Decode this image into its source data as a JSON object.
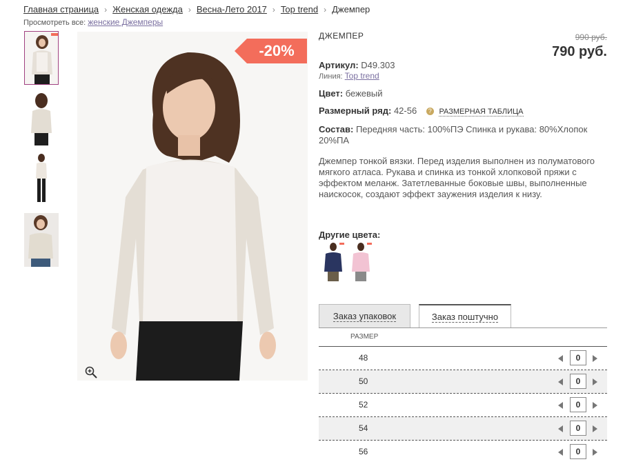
{
  "breadcrumb": {
    "items": [
      "Главная страница",
      "Женская одежда",
      "Весна-Лето 2017",
      "Top trend"
    ],
    "separator": "›",
    "current": "Джемпер"
  },
  "see_all": {
    "label": "Просмотреть все:",
    "link": "женские Джемперы"
  },
  "gallery": {
    "thumbnails": [
      "front-view",
      "back-view",
      "full-length-view",
      "model-view"
    ],
    "active_index": 0,
    "discount_badge": "-20%",
    "badge_color": "#f36d5b"
  },
  "product": {
    "title": "ДЖЕМПЕР",
    "old_price": "990 руб.",
    "price": "790 руб.",
    "article_label": "Артикул:",
    "article_value": "D49.303",
    "line_label": "Линия:",
    "line_value": "Top trend",
    "color_label": "Цвет:",
    "color_value": "бежевый",
    "size_range_label": "Размерный ряд:",
    "size_range_value": "42-56",
    "size_table_link": "РАЗМЕРНАЯ ТАБЛИЦА",
    "composition_label": "Состав:",
    "composition_value": "Передняя часть: 100%ПЭ Спинка и рукава: 80%Хлопок 20%ПА",
    "description": "Джемпер тонкой вязки. Перед изделия выполнен из полуматового мягкого атласа. Рукава и спинка из тонкой хлопковой пряжи с эффектом меланж. Затетлеванные боковые швы, выполненные наискосок, создают эффект заужения изделия к низу.",
    "other_colors_label": "Другие цвета:",
    "other_colors": [
      "#2a3560",
      "#f2c3d3"
    ]
  },
  "order": {
    "tabs": [
      "Заказ упаковок",
      "Заказ поштучно"
    ],
    "active_tab": 1,
    "size_header": "РАЗМЕР",
    "rows": [
      {
        "size": "48",
        "qty": "0"
      },
      {
        "size": "50",
        "qty": "0"
      },
      {
        "size": "52",
        "qty": "0"
      },
      {
        "size": "54",
        "qty": "0"
      },
      {
        "size": "56",
        "qty": "0"
      }
    ]
  }
}
